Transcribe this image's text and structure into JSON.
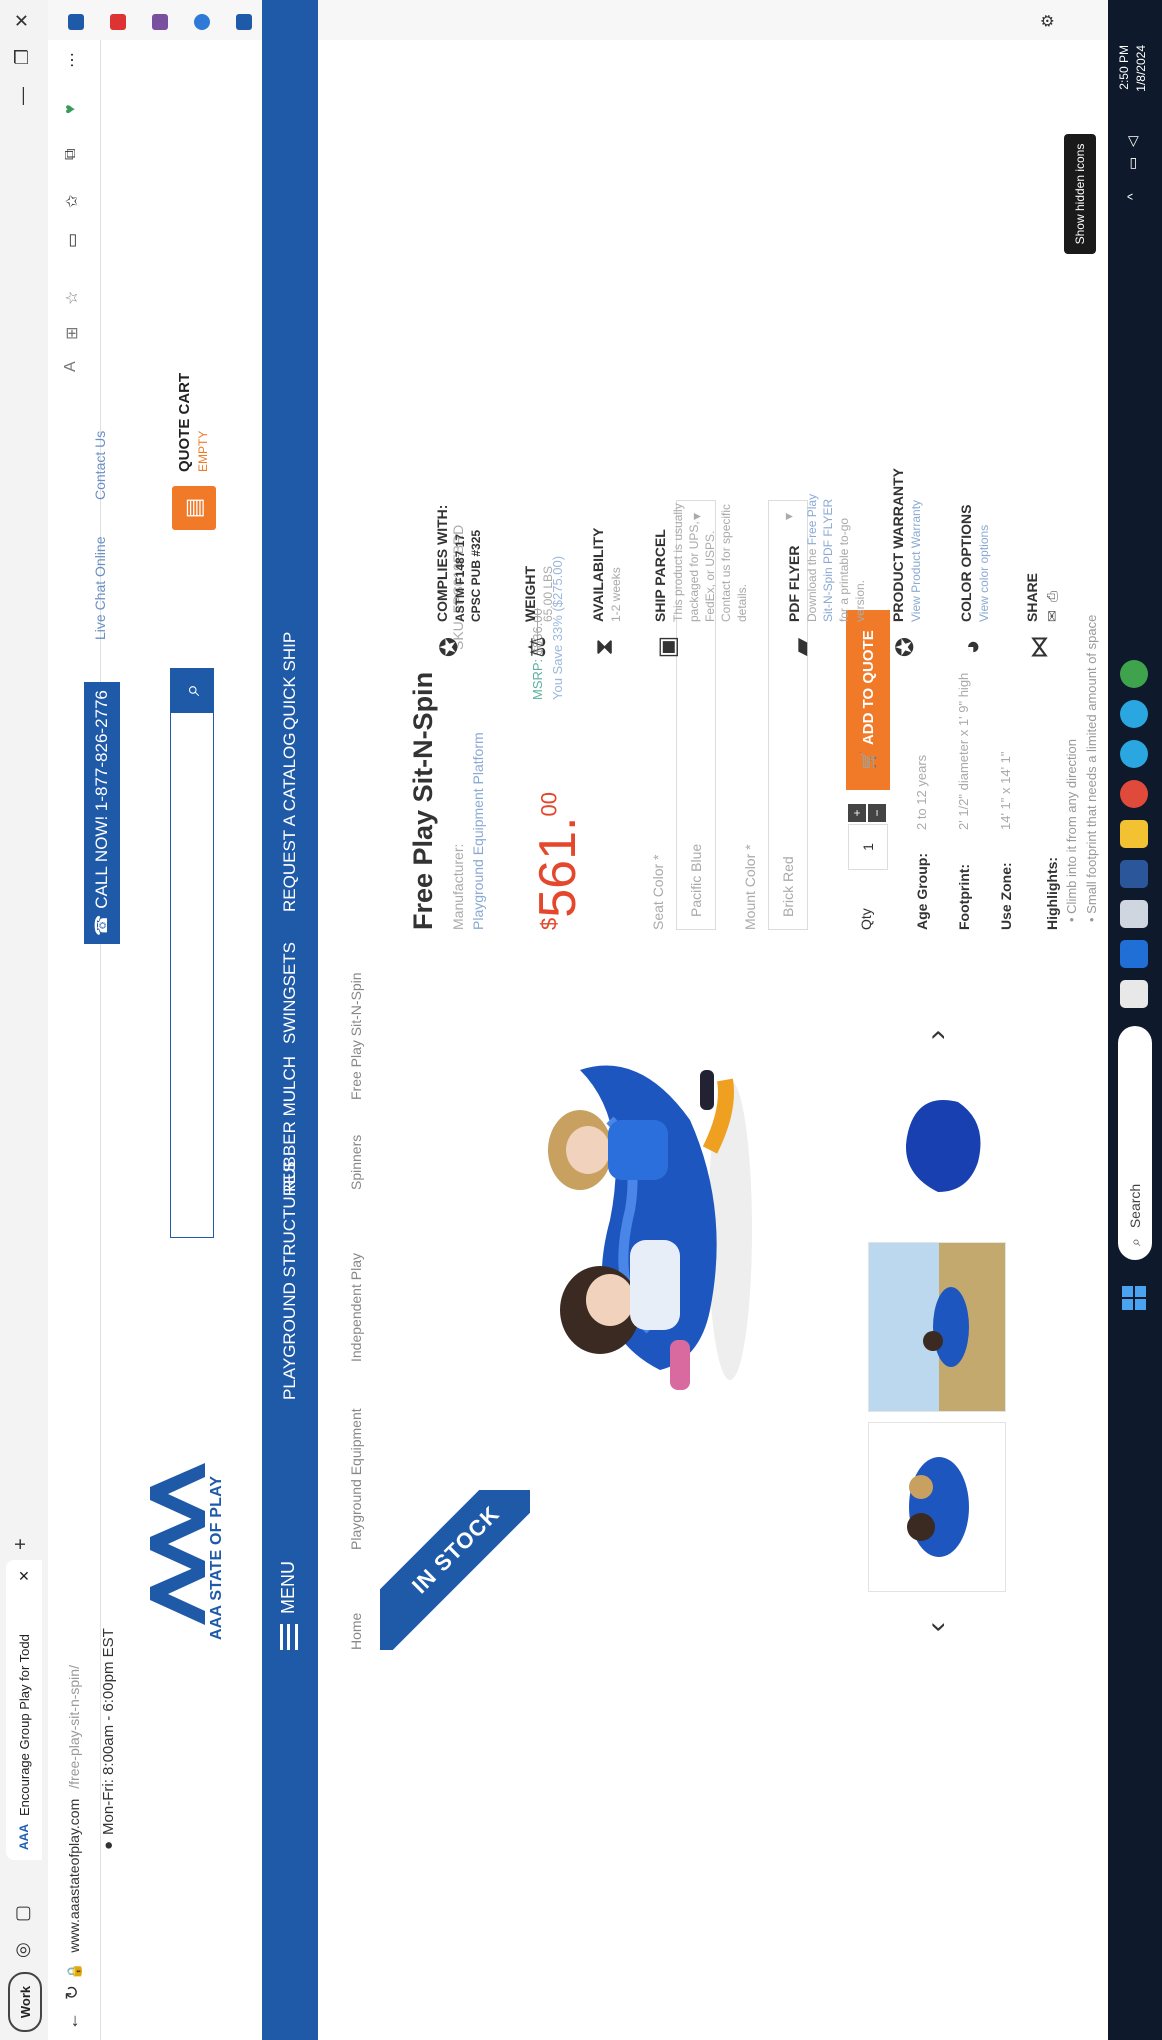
{
  "browser": {
    "profile_chip": "Work",
    "tab_title": "Encourage Group Play for Todd",
    "tab_favicon": "AAA",
    "url": "https://www.aaastateofplay.com/free-play-sit-n-spin/",
    "url_host": "www.aaastateofplay.com",
    "url_rest": "/free-play-sit-n-spin/"
  },
  "header": {
    "hours": "Mon-Fri: 8:00am - 6:00pm EST",
    "call_now": "CALL NOW! 1-877-826-2776",
    "live_chat": "Live Chat Online",
    "contact_us": "Contact Us",
    "logo_text": "AAA STATE OF PLAY",
    "quote_cart_title": "QUOTE CART",
    "quote_cart_status": "EMPTY"
  },
  "nav": {
    "menu": "MENU",
    "items": [
      "PLAYGROUND STRUCTURES",
      "RUBBER MULCH",
      "SWINGSETS",
      "REQUEST A CATALOG",
      "QUICK SHIP"
    ]
  },
  "breadcrumb": [
    "Home",
    "Playground Equipment",
    "Independent Play",
    "Spinners",
    "Free Play Sit-N-Spin"
  ],
  "product": {
    "badge": "IN STOCK",
    "title": "Free Play Sit-N-Spin",
    "manufacturer_label": "Manufacturer:",
    "manufacturer": "Playground Equipment Platform",
    "sku": "SKU: FPS019FBRD",
    "price_main": "561.",
    "price_cents": "00",
    "price_symbol": "$",
    "msrp_label": "MSRP:",
    "msrp_value": "$836.00",
    "you_save": "You Save 33% ($275.00)",
    "seat_color_label": "Seat Color *",
    "seat_color_value": "Pacific Blue",
    "mount_color_label": "Mount Color *",
    "mount_color_value": "Brick Red",
    "qty_label": "Qty",
    "qty_value": "1",
    "add_to_quote": "ADD TO QUOTE",
    "specs": [
      {
        "label": "Age Group:",
        "value": "2 to 12 years"
      },
      {
        "label": "Footprint:",
        "value": "2' 1/2\" diameter x 1' 9\" high"
      },
      {
        "label": "Use Zone:",
        "value": "14' 1\" x 14' 1\""
      }
    ],
    "highlights_title": "Highlights:",
    "highlights": [
      "Climb into it from any direction",
      "Small footprint that needs a limited amount of space"
    ]
  },
  "info": {
    "complies_title": "COMPLIES WITH:",
    "complies_1": "ASTM F1487 17",
    "complies_2": "CPSC PUB #325",
    "weight_title": "WEIGHT",
    "weight_value": "65.00 LBS",
    "availability_title": "AVAILABILITY",
    "availability_value": "1-2 weeks",
    "ship_title": "SHIP PARCEL",
    "ship_text": "This product is usually packaged for UPS, FedEx, or USPS. Contact us for specific details.",
    "flyer_title": "PDF FLYER",
    "flyer_text_1": "Download the",
    "flyer_link": "Free Play Sit-N-Spin PDF FLYER",
    "flyer_text_2": "for a printable to-go version.",
    "warranty_title": "PRODUCT WARRANTY",
    "warranty_link": "View Product Warranty",
    "color_title": "COLOR OPTIONS",
    "color_link": "View color options",
    "share_title": "SHARE"
  },
  "taskbar": {
    "search_placeholder": "Search",
    "time": "2:50 PM",
    "date": "1/8/2024",
    "tooltip": "Show hidden icons"
  },
  "colors": {
    "brand_blue": "#1f5aa8",
    "accent_orange": "#f07a28",
    "price_red": "#e4472c",
    "taskbar": "#0e1a2b"
  }
}
